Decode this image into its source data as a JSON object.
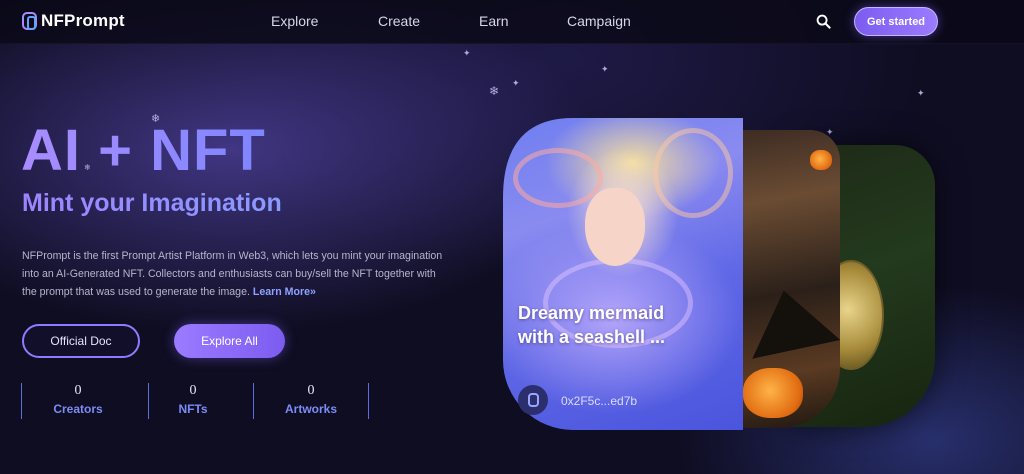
{
  "nav": {
    "brand": "NFPrompt",
    "items": [
      "Explore",
      "Create",
      "Earn",
      "Campaign"
    ],
    "cta": "Get started"
  },
  "hero": {
    "title": "AI + NFT",
    "subtitle": "Mint your Imagination",
    "description": "NFPrompt is the first Prompt Artist Platform in Web3, which lets you mint your imagination into an AI-Generated NFT. Collectors and enthusiasts can buy/sell the NFT together with the prompt that was used to generate the image.",
    "learn_more": "Learn More»",
    "btn_doc": "Official Doc",
    "btn_explore": "Explore All",
    "stats": [
      {
        "value": "0",
        "label": "Creators"
      },
      {
        "value": "0",
        "label": "NFTs"
      },
      {
        "value": "0",
        "label": "Artworks"
      }
    ]
  },
  "featured": {
    "title": "Dreamy mermaid with a seashell ...",
    "owner": "0x2F5c...ed7b"
  },
  "colors": {
    "accent": "#8b6cff",
    "background": "#0f0d22",
    "stat_label": "#7d8cf5"
  },
  "icons": [
    "logo-icon",
    "search-icon",
    "avatar-icon",
    "sparkle-icon"
  ]
}
